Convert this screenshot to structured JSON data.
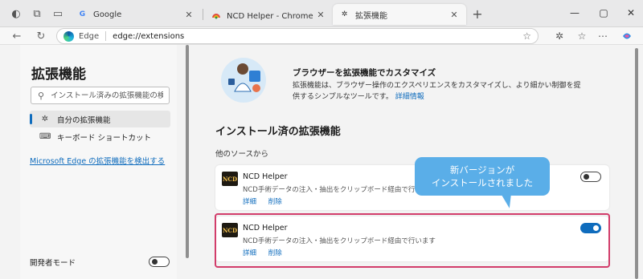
{
  "browser": {
    "tabs": [
      {
        "title": "Google",
        "favicon": "google-icon"
      },
      {
        "title": "NCD Helper - Chrome ウェブストア",
        "favicon": "chrome-webstore-icon"
      },
      {
        "title": "拡張機能",
        "favicon": "extensions-icon"
      }
    ],
    "address": {
      "label": "Edge",
      "url": "edge://extensions"
    }
  },
  "sidebar": {
    "title": "拡張機能",
    "search_placeholder": "インストール済みの拡張機能の検索",
    "items": [
      {
        "label": "自分の拡張機能",
        "icon": "puzzle-icon"
      },
      {
        "label": "キーボード ショートカット",
        "icon": "keyboard-icon"
      }
    ],
    "link": "Microsoft Edge の拡張機能を検出する",
    "dev_mode_label": "開発者モード",
    "dev_mode": false
  },
  "main": {
    "hero_title": "ブラウザーを拡張機能でカスタマイズ",
    "hero_desc": "拡張機能は、ブラウザー操作のエクスペリエンスをカスタマイズし、より細かい制御を提供するシンプルなツールです。",
    "hero_link": "詳細情報",
    "section_title": "インストール済の拡張機能",
    "subsection_title": "他のソースから",
    "extensions": [
      {
        "name": "NCD Helper",
        "logo": "NCD",
        "desc": "NCD手術データの注入・抽出をクリップボード経由で行います",
        "details": "詳細",
        "remove": "削除",
        "enabled": false
      },
      {
        "name": "NCD Helper",
        "logo": "NCD",
        "desc": "NCD手術データの注入・抽出をクリップボード経由で行います",
        "details": "詳細",
        "remove": "削除",
        "enabled": true
      }
    ]
  },
  "callout": {
    "line1": "新バージョンが",
    "line2": "インストールされました"
  },
  "colors": {
    "accent": "#0f6cbd",
    "highlight": "#d23c6a",
    "callout": "#5aaee8"
  }
}
